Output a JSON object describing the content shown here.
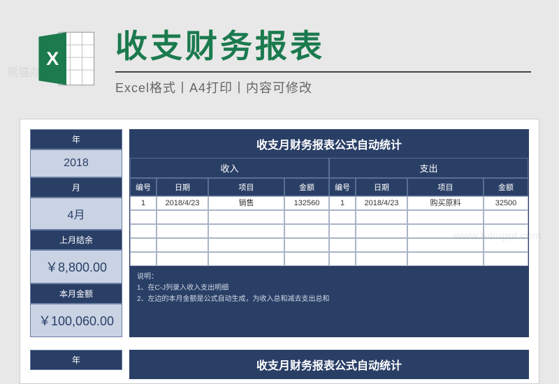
{
  "watermark": "熊猫办公",
  "watermark2": "www.tukuppt.com",
  "header": {
    "title": "收支财务报表",
    "subtitle": "Excel格式丨A4打印丨内容可修改"
  },
  "left": {
    "year_label": "年",
    "year_value": "2018",
    "month_label": "月",
    "month_value": "4月",
    "prev_balance_label": "上月结余",
    "prev_balance_value": "￥8,800.00",
    "this_month_label": "本月金额",
    "this_month_value": "￥100,060.00",
    "year_label2": "年"
  },
  "table": {
    "title": "收支月财务报表公式自动统计",
    "income_label": "收入",
    "expense_label": "支出",
    "cols": {
      "no": "编号",
      "date": "日期",
      "item": "项目",
      "amount": "金额"
    },
    "rows": [
      {
        "in_no": "1",
        "in_date": "2018/4/23",
        "in_item": "销售",
        "in_amt": "132560",
        "out_no": "1",
        "out_date": "2018/4/23",
        "out_item": "购买原料",
        "out_amt": "32500"
      },
      {
        "in_no": "",
        "in_date": "",
        "in_item": "",
        "in_amt": "",
        "out_no": "",
        "out_date": "",
        "out_item": "",
        "out_amt": ""
      },
      {
        "in_no": "",
        "in_date": "",
        "in_item": "",
        "in_amt": "",
        "out_no": "",
        "out_date": "",
        "out_item": "",
        "out_amt": ""
      },
      {
        "in_no": "",
        "in_date": "",
        "in_item": "",
        "in_amt": "",
        "out_no": "",
        "out_date": "",
        "out_item": "",
        "out_amt": ""
      },
      {
        "in_no": "",
        "in_date": "",
        "in_item": "",
        "in_amt": "",
        "out_no": "",
        "out_date": "",
        "out_item": "",
        "out_amt": ""
      }
    ],
    "notes_title": "说明：",
    "note1": "1、在C-J列录入收入支出明细",
    "note2": "2、左边的本月金额是公式自动生成，为收入总和减去支出总和"
  },
  "table2_title": "收支月财务报表公式自动统计"
}
